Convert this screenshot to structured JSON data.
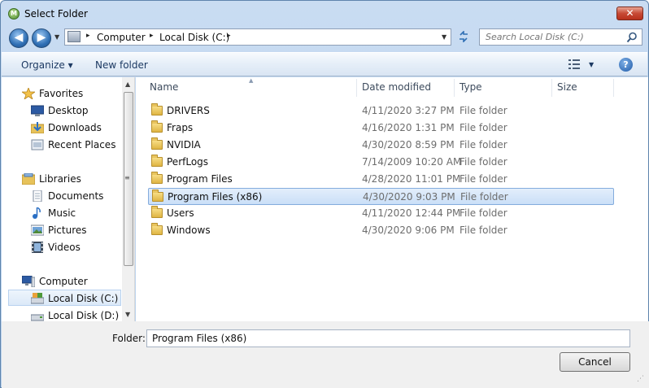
{
  "window": {
    "title": "Select Folder",
    "close_label": "✕",
    "app_icon_label": "M"
  },
  "address": {
    "back_glyph": "◀",
    "forward_glyph": "▶",
    "crumbs": [
      "Computer",
      "Local Disk (C:)"
    ],
    "separator": "▸",
    "search_placeholder": "Search Local Disk (C:)"
  },
  "toolbar": {
    "organize_label": "Organize ▾",
    "new_folder_label": "New folder",
    "help_label": "?"
  },
  "sidebar": {
    "groups": [
      {
        "label": "Favorites",
        "icon": "star-icon"
      },
      {
        "label": "Libraries",
        "icon": "libraries-icon"
      },
      {
        "label": "Computer",
        "icon": "computer-icon"
      }
    ],
    "items": [
      {
        "label": "Favorites",
        "icon": "star-icon"
      },
      {
        "label": "Desktop",
        "icon": "desktop-icon"
      },
      {
        "label": "Downloads",
        "icon": "downloads-icon"
      },
      {
        "label": "Recent Places",
        "icon": "recent-places-icon"
      },
      {
        "label": "Libraries",
        "icon": "libraries-icon"
      },
      {
        "label": "Documents",
        "icon": "documents-icon"
      },
      {
        "label": "Music",
        "icon": "music-icon"
      },
      {
        "label": "Pictures",
        "icon": "pictures-icon"
      },
      {
        "label": "Videos",
        "icon": "videos-icon"
      },
      {
        "label": "Computer",
        "icon": "computer-icon"
      },
      {
        "label": "Local Disk (C:)",
        "icon": "drive-icon",
        "selected": true
      },
      {
        "label": "Local Disk (D:)",
        "icon": "drive-icon"
      }
    ]
  },
  "columns": {
    "name": "Name",
    "date": "Date modified",
    "type": "Type",
    "size": "Size"
  },
  "files": [
    {
      "name": "DRIVERS",
      "date": "4/11/2020 3:27 PM",
      "type": "File folder"
    },
    {
      "name": "Fraps",
      "date": "4/16/2020 1:31 PM",
      "type": "File folder"
    },
    {
      "name": "NVIDIA",
      "date": "4/30/2020 8:59 PM",
      "type": "File folder"
    },
    {
      "name": "PerfLogs",
      "date": "7/14/2009 10:20 AM",
      "type": "File folder"
    },
    {
      "name": "Program Files",
      "date": "4/28/2020 11:01 PM",
      "type": "File folder"
    },
    {
      "name": "Program Files (x86)",
      "date": "4/30/2020 9:03 PM",
      "type": "File folder",
      "selected": true
    },
    {
      "name": "Users",
      "date": "4/11/2020 12:44 PM",
      "type": "File folder"
    },
    {
      "name": "Windows",
      "date": "4/30/2020 9:06 PM",
      "type": "File folder"
    }
  ],
  "footer": {
    "folder_label": "Folder:",
    "folder_value": "Program Files (x86)",
    "cancel_label": "Cancel"
  },
  "colors": {
    "selection_border": "#84acdd",
    "selection_fill": "#cadff7",
    "toolbar_text": "#1d3a63",
    "close_red": "#c74a35"
  }
}
